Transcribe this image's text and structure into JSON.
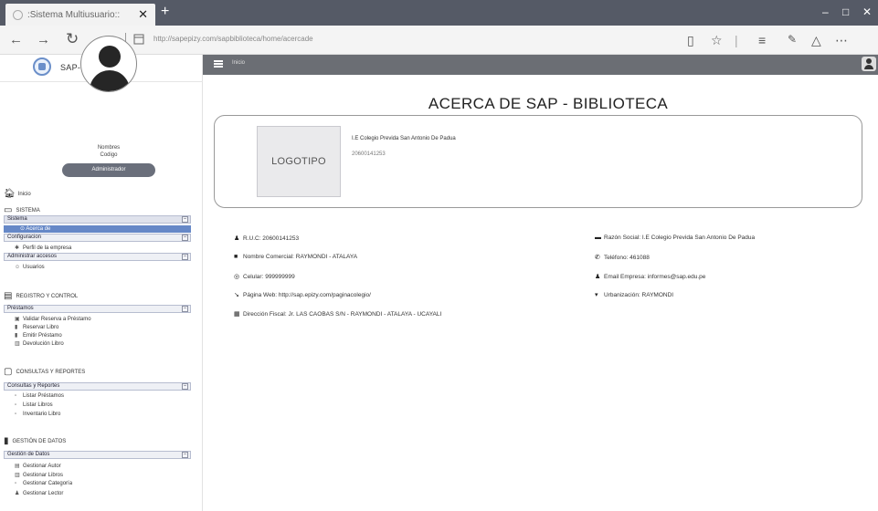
{
  "browser": {
    "tab_title": ":Sistema Multiusuario::",
    "tab_close": "✕",
    "new_tab": "+",
    "url": "http://sapepizy.com/sapbiblioteca/home/acercade",
    "win_min": "–",
    "win_max": "□",
    "win_close": "✕"
  },
  "app": {
    "brand": "SAP-BIBLIOTECA",
    "user": {
      "name": "Nombres",
      "code": "Codigo",
      "role": "Administrador"
    },
    "home_label": "Inicio"
  },
  "sidebar": {
    "sistema": {
      "title": "SISTEMA",
      "group": "Sistema",
      "selected": "Acerca de",
      "config_group": "Configuracion",
      "config_item": "Perfil de la empresa",
      "access_group": "Administrar accesos",
      "access_item": "Usuarios"
    },
    "registro": {
      "title": "REGISTRO Y CONTROL",
      "group": "Préstamos",
      "items": [
        "Validar Reserva a Préstamo",
        "Reservar Libro",
        "Emitir Préstamo",
        "Devolución Libro"
      ]
    },
    "consultas": {
      "title": "CONSULTAS Y REPORTES",
      "group": "Consultas y Reportes",
      "items": [
        "Listar Préstamos",
        "Listar Libros",
        "Inventario Libro"
      ]
    },
    "gestion": {
      "title": "GESTIÓN DE DATOS",
      "group": "Gestión de Datos",
      "items": [
        "Gestionar Autor",
        "Gestionar Libros",
        "Gestionar Categoría",
        "Gestionar Lector"
      ]
    }
  },
  "main": {
    "breadcrumb": "Inicio",
    "title": "ACERCA DE SAP - BIBLIOTECA",
    "logo_placeholder": "LOGOTIPO",
    "institution": "I.E Colegio Previda San Antonio De Padua",
    "institution_ruc": "20600141253",
    "info_left": [
      {
        "icon": "user-icon",
        "glyph": "♟",
        "text": "R.U.C: 20600141253"
      },
      {
        "icon": "briefcase-icon",
        "glyph": "■",
        "text": "Nombre Comercial: RAYMONDI - ATALAYA"
      },
      {
        "icon": "whatsapp-icon",
        "glyph": "◎",
        "text": "Celular: 999999999"
      },
      {
        "icon": "link-icon",
        "glyph": "↘",
        "text": "Página Web: http://sap.epizy.com/paginacolegio/"
      },
      {
        "icon": "building-icon",
        "glyph": "▦",
        "text": "Dirección Fiscal: Jr. LAS CAOBAS S/N - RAYMONDI - ATALAYA - UCAYALI"
      }
    ],
    "info_right": [
      {
        "icon": "card-icon",
        "glyph": "▬",
        "text": "Razón Social: I.E Colegio Previda San Antonio De Padua"
      },
      {
        "icon": "phone-icon",
        "glyph": "✆",
        "text": "Teléfono: 461088"
      },
      {
        "icon": "user-icon",
        "glyph": "♟",
        "text": "Email Empresa: informes@sap.edu.pe"
      },
      {
        "icon": "map-marker-icon",
        "glyph": "▾",
        "text": "Urbanización: RAYMONDI"
      }
    ]
  }
}
